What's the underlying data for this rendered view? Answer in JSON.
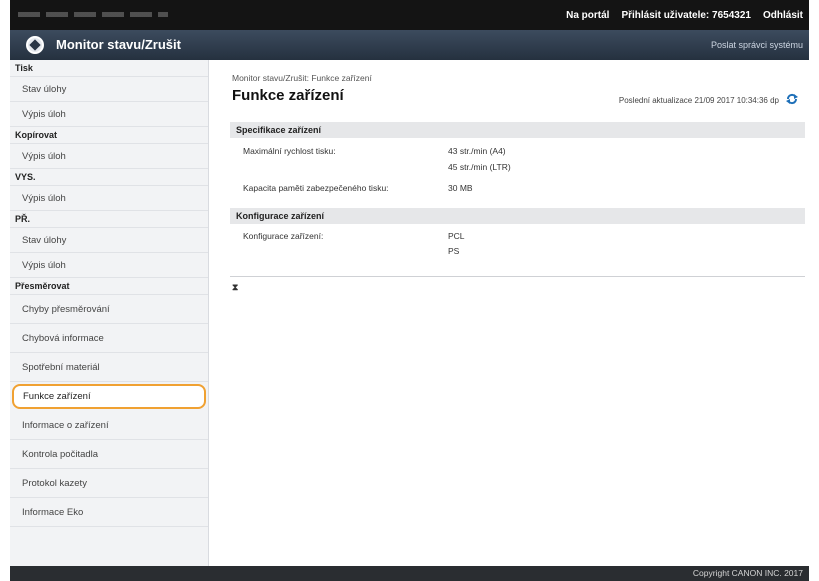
{
  "topbar": {
    "portal_link": "Na portál",
    "login_label": "Přihlásit uživatele:",
    "user_id": "7654321",
    "logout": "Odhlásit"
  },
  "header": {
    "title": "Monitor stavu/Zrušit",
    "admin_link": "Poslat správci systému"
  },
  "sidebar": {
    "groups": [
      {
        "label": "Tisk",
        "items": [
          "Stav úlohy",
          "Výpis úloh"
        ]
      },
      {
        "label": "Kopírovat",
        "items": [
          "Výpis úloh"
        ]
      },
      {
        "label": "VYS.",
        "items": [
          "Výpis úloh"
        ]
      },
      {
        "label": "PŘ.",
        "items": [
          "Stav úlohy",
          "Výpis úloh"
        ]
      },
      {
        "label": "Přesměrovat",
        "items": [
          "Chyby přesměrování"
        ]
      }
    ],
    "extra": [
      "Chybová informace",
      "Spotřební materiál",
      "Funkce zařízení",
      "Informace o zařízení",
      "Kontrola počitadla",
      "Protokol kazety",
      "Informace Eko"
    ],
    "active": "Funkce zařízení"
  },
  "main": {
    "breadcrumb": "Monitor stavu/Zrušit: Funkce zařízení",
    "title": "Funkce zařízení",
    "last_updated": "Poslední aktualizace 21/09 2017 10:34:36 dp",
    "specs": {
      "heading": "Specifikace zařízení",
      "max_speed_label": "Maximální rychlost tisku:",
      "max_speed_a4": "43 str./min (A4)",
      "max_speed_ltr": "45 str./min (LTR)",
      "memory_label": "Kapacita paměti zabezpečeného tisku:",
      "memory_value": "30 MB"
    },
    "config": {
      "heading": "Konfigurace zařízení",
      "label": "Konfigurace zařízení:",
      "values": [
        "PCL",
        "PS"
      ]
    },
    "back_to_top": "⧗"
  },
  "footer": {
    "copyright": "Copyright CANON INC. 2017"
  }
}
